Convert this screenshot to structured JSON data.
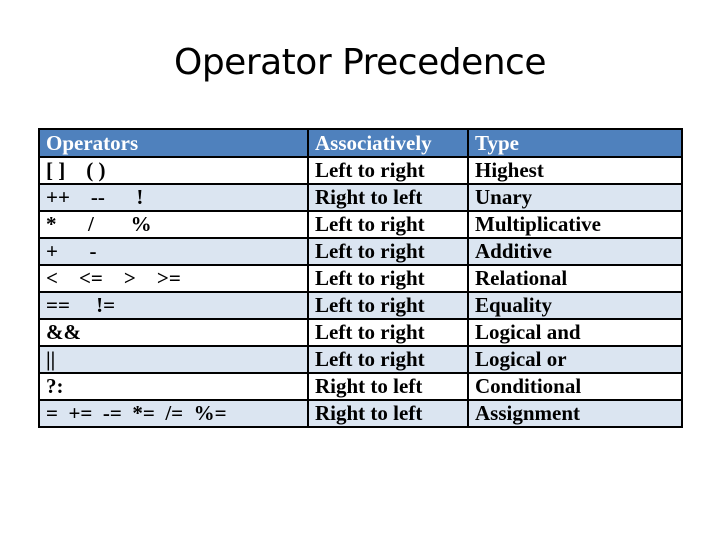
{
  "title": "Operator Precedence",
  "table": {
    "headers": [
      "Operators",
      "Associatively",
      "Type"
    ],
    "rows": [
      {
        "operators": "[ ]    ( )",
        "associativity": "Left to right",
        "type": "Highest"
      },
      {
        "operators": "++    --      !",
        "associativity": "Right to left",
        "type": "Unary"
      },
      {
        "operators": "*      /       %",
        "associativity": "Left to right",
        "type": "Multiplicative"
      },
      {
        "operators": "+      -",
        "associativity": "Left to right",
        "type": "Additive"
      },
      {
        "operators": "<    <=    >    >=",
        "associativity": "Left to right",
        "type": "Relational"
      },
      {
        "operators": "==     !=",
        "associativity": "Left to right",
        "type": "Equality"
      },
      {
        "operators": "&&",
        "associativity": "Left to right",
        "type": "Logical and"
      },
      {
        "operators": "||",
        "associativity": "Left to right",
        "type": "Logical or"
      },
      {
        "operators": "?:",
        "associativity": "Right to left",
        "type": "Conditional"
      },
      {
        "operators": "=  +=  -=  *=  /=  %=",
        "associativity": "Right to left",
        "type": "Assignment"
      }
    ]
  },
  "colors": {
    "header_bg": "#4f81bd",
    "header_text": "#ffffff",
    "band_light": "#ffffff",
    "band_shaded": "#dbe5f1"
  }
}
